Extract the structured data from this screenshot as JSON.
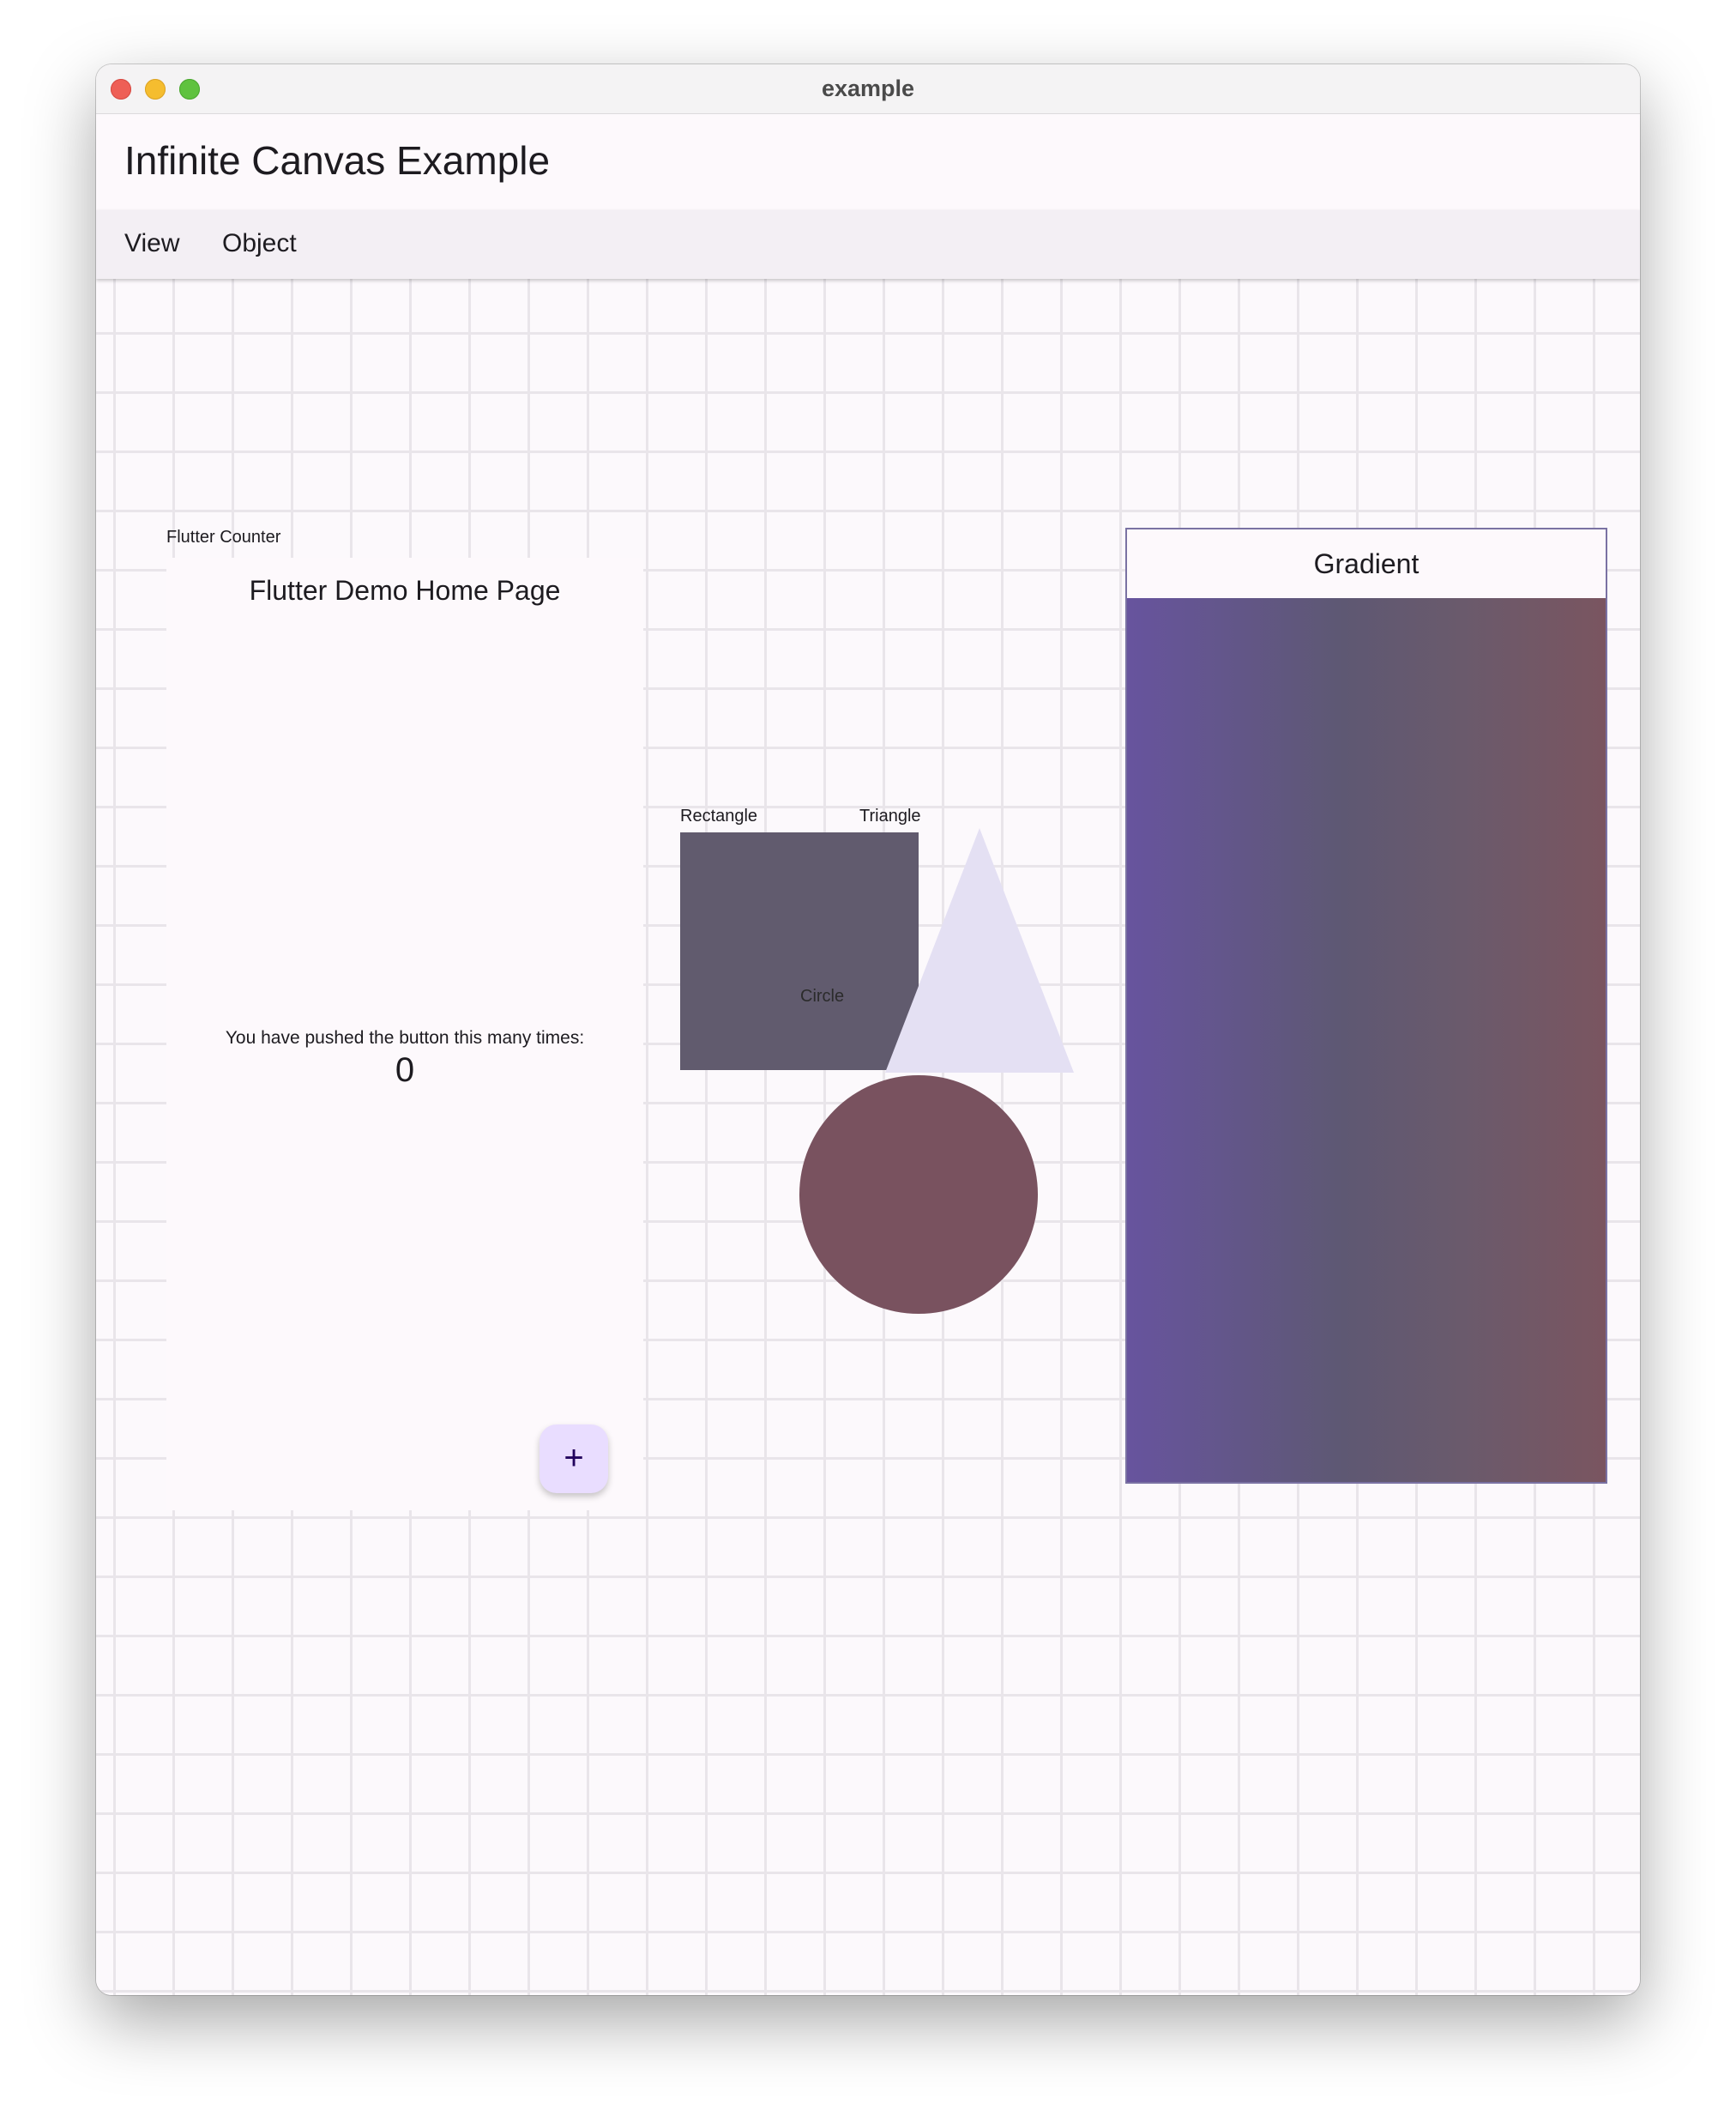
{
  "window": {
    "title": "example"
  },
  "app": {
    "title": "Infinite Canvas Example"
  },
  "menu": {
    "items": [
      {
        "label": "View"
      },
      {
        "label": "Object"
      }
    ]
  },
  "canvas": {
    "counter_node": {
      "label": "Flutter Counter",
      "header": "Flutter Demo Home Page",
      "text": "You have pushed the button this many times:",
      "count": "0",
      "fab_icon": "plus-icon",
      "fab_symbol": "+"
    },
    "rectangle_node": {
      "label": "Rectangle",
      "color": "#615b6e"
    },
    "triangle_node": {
      "label": "Triangle",
      "color": "#e4e0f3"
    },
    "circle_node": {
      "label": "Circle",
      "color": "#79525f"
    },
    "gradient_node": {
      "title": "Gradient",
      "colors": [
        "#67549e",
        "#5e5873",
        "#7a5560"
      ]
    }
  }
}
